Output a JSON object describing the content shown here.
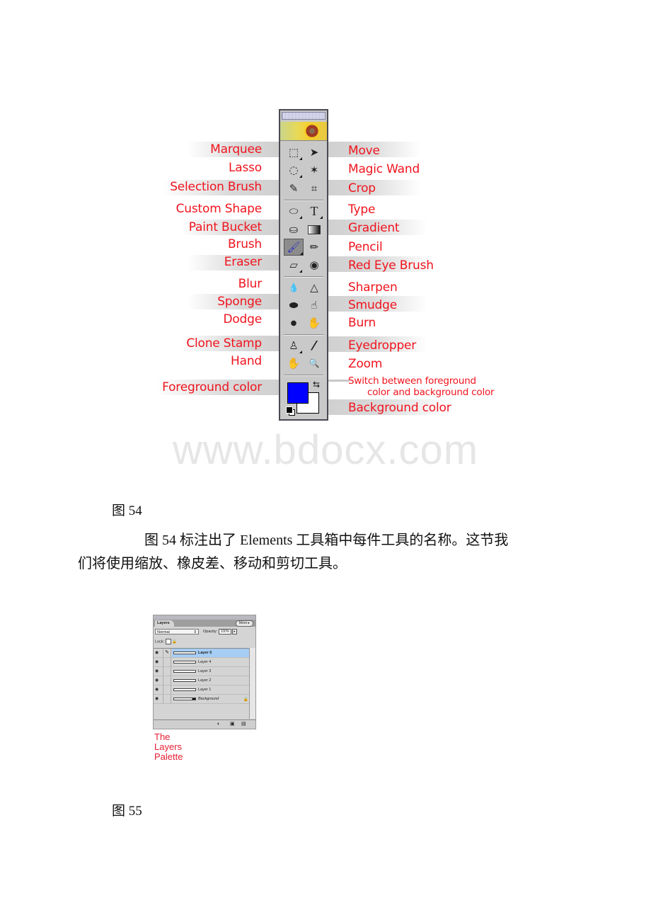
{
  "figure54": {
    "toolbox": {
      "left_labels": [
        "Marquee",
        "Lasso",
        "Selection Brush",
        "Custom Shape",
        "Paint Bucket",
        "Brush",
        "Eraser",
        "Blur",
        "Sponge",
        "Dodge",
        "Clone Stamp",
        "Hand",
        "Foreground color"
      ],
      "right_labels": [
        "Move",
        "Magic Wand",
        "Crop",
        "Type",
        "Gradient",
        "Pencil",
        "Red Eye Brush",
        "Sharpen",
        "Smudge",
        "Burn",
        "Eyedropper",
        "Zoom",
        "Switch between foreground",
        "color and background color",
        "Background color"
      ],
      "icons": {
        "marquee": "⬚",
        "move": "➤",
        "lasso": "◌",
        "magic_wand": "✶",
        "selection_brush": "✎",
        "crop": "⌗",
        "custom_shape": "⬭",
        "type": "T",
        "paint_bucket": "⛀",
        "gradient": "▮",
        "brush": "🖌",
        "pencil": "✏",
        "eraser": "▱",
        "red_eye_brush": "◉",
        "blur": "💧",
        "sharpen": "△",
        "sponge": "⬬",
        "smudge": "☝",
        "dodge": "●",
        "burn": "✋",
        "clone_stamp": "♙",
        "eyedropper": "⁄",
        "hand": "✋",
        "zoom": "🔍",
        "swap": "⇆"
      },
      "foreground_color": "#0000ff",
      "background_color": "#ffffff",
      "label_color": "#f0141e"
    },
    "watermark": "www.bdocx.com",
    "caption": "图 54"
  },
  "paragraph": {
    "line1": "图 54 标注出了 Elements 工具箱中每件工具的名称。这节我",
    "line2": "们将使用缩放、橡皮差、移动和剪切工具。"
  },
  "figure55": {
    "layers_palette": {
      "tab": "Layers",
      "more_button": "More ▸",
      "blend_mode": "Normal",
      "opacity_label": "Opacity:",
      "opacity_value": "100%",
      "lock_label": "Lock:",
      "layers": [
        {
          "name": "Layer 5",
          "selected": true
        },
        {
          "name": "Layer 4",
          "selected": false
        },
        {
          "name": "Layer 3",
          "selected": false
        },
        {
          "name": "Layer 2",
          "selected": false
        },
        {
          "name": "Layer 1",
          "selected": false
        },
        {
          "name": "Background",
          "selected": false,
          "locked": true
        }
      ],
      "caption_lines": [
        "The",
        "Layers",
        "Palette"
      ]
    },
    "caption": "图 55"
  }
}
